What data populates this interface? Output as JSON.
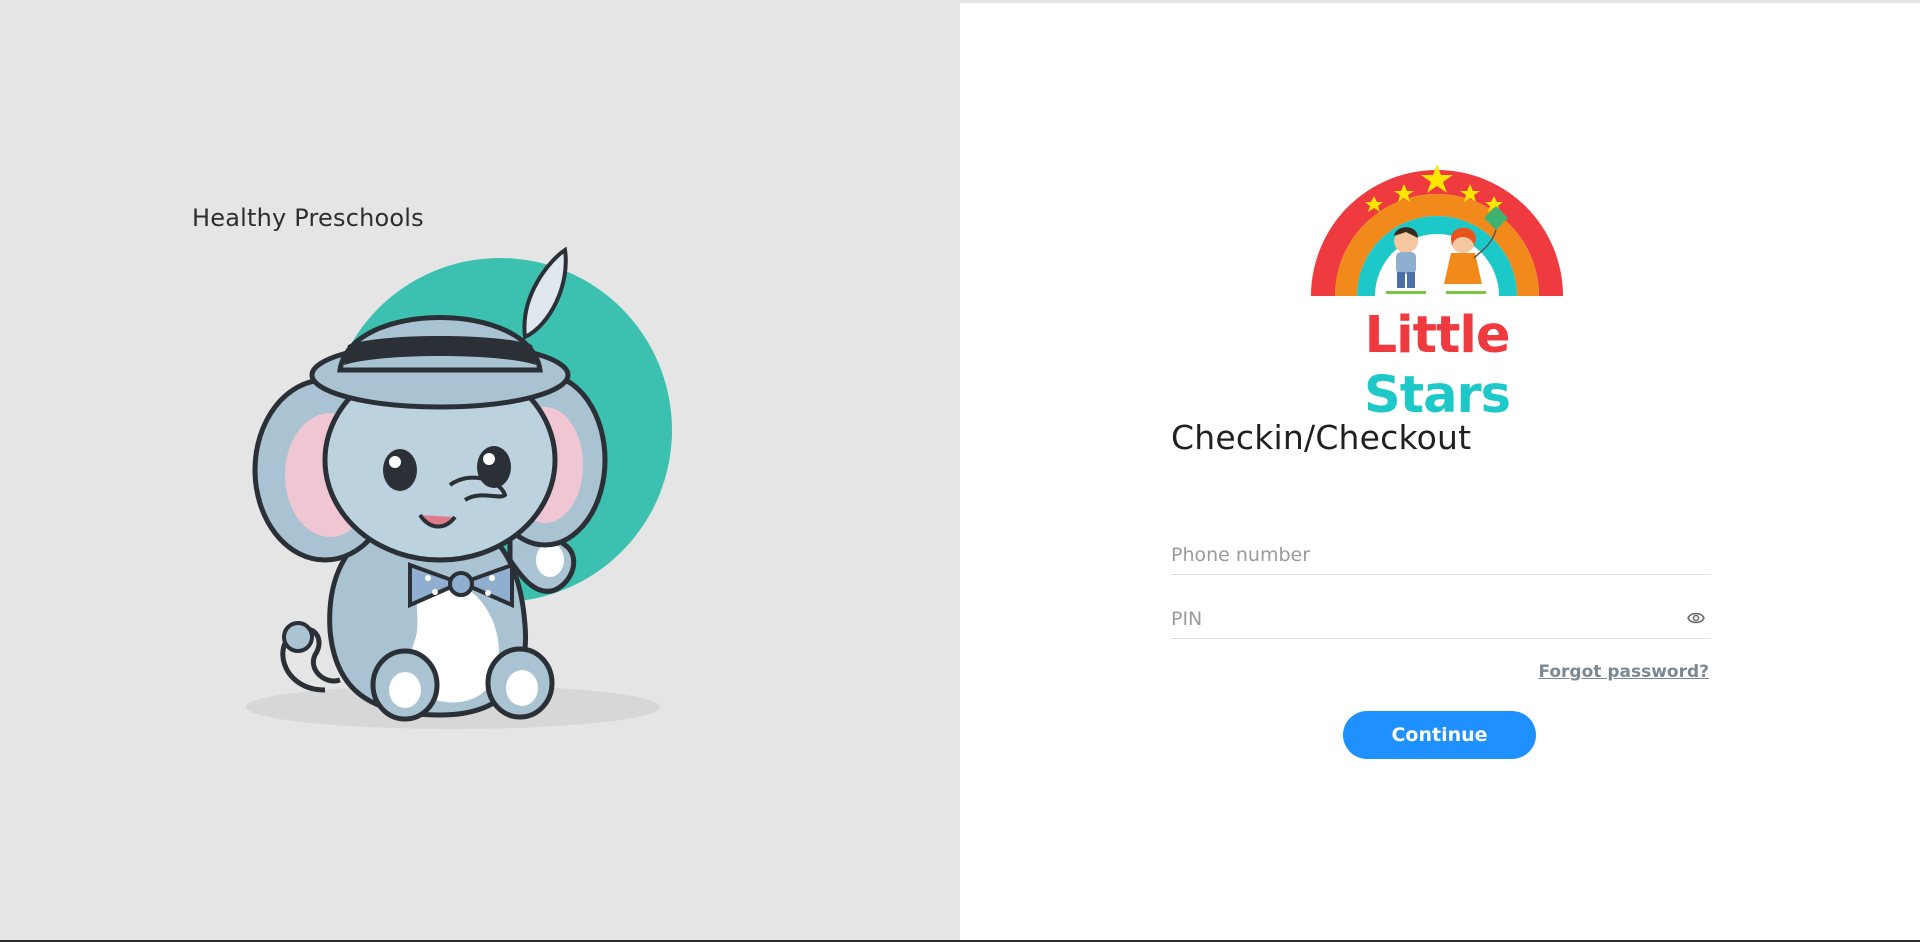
{
  "left_panel": {
    "brand_text": "Healthy Preschools",
    "illustration": "elephant-mascot-illustration"
  },
  "logo": {
    "word_1": "Little",
    "word_2": "Stars",
    "icon": "rainbow-kids-logo"
  },
  "form": {
    "title": "Checkin/Checkout",
    "phone_placeholder": "Phone number",
    "pin_placeholder": "PIN",
    "pin_toggle_icon": "eye-icon",
    "forgot_label": "Forgot password?",
    "continue_label": "Continue"
  },
  "colors": {
    "left_bg": "#e5e5e5",
    "accent_teal": "#3cc0b0",
    "primary_button": "#1e90ff",
    "logo_red": "#ef3a3f",
    "logo_teal": "#1cc8c8"
  }
}
